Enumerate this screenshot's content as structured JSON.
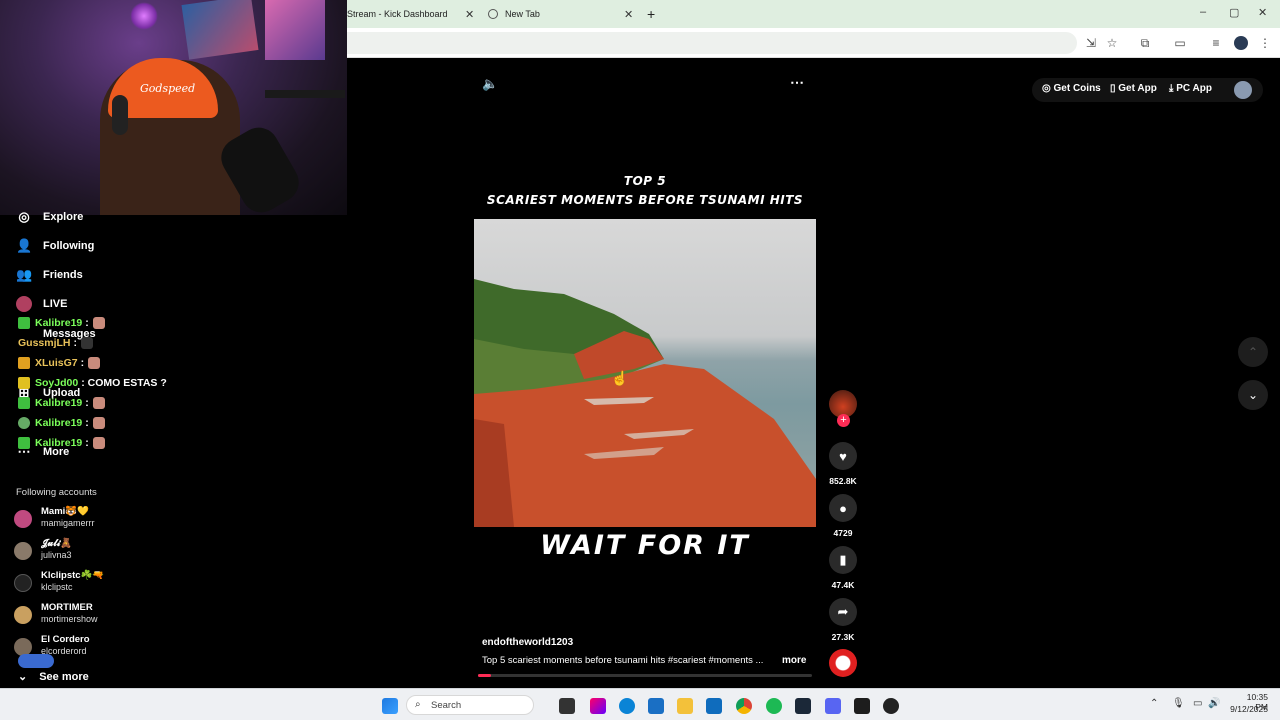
{
  "browser": {
    "tabs": [
      {
        "label": "Stream - Kick Dashboard"
      },
      {
        "label": "New Tab"
      }
    ],
    "new_tab_symbol": "+",
    "window_controls": {
      "minimize": "–",
      "restore": "▢",
      "close": "✕"
    }
  },
  "webcam": {
    "hat_text": "Godspeed"
  },
  "tiktok_nav": {
    "items": [
      {
        "label": "Explore",
        "icon": "compass-icon"
      },
      {
        "label": "Following",
        "icon": "following-icon"
      },
      {
        "label": "Friends",
        "icon": "friends-icon"
      },
      {
        "label": "LIVE",
        "icon": "live-icon"
      },
      {
        "label": "Messages",
        "icon": "messages-icon"
      },
      {
        "label": "Upload",
        "icon": "upload-icon"
      },
      {
        "label": "More",
        "icon": "more-icon"
      }
    ],
    "following_label": "Following accounts",
    "accounts": [
      {
        "name": "Mami🐯💛",
        "handle": "mamigamerrr"
      },
      {
        "name": "𝓙𝓾𝓵𝓲🧸",
        "handle": "julivna3"
      },
      {
        "name": "Klclipstc☘️🔫",
        "handle": "klclipstc"
      },
      {
        "name": "MORTIMER",
        "handle": "mortimershow"
      },
      {
        "name": "El Cordero",
        "handle": "elcorderord"
      }
    ],
    "see_more": "See more"
  },
  "chat": [
    {
      "user": "Kalibre19",
      "msg": ":",
      "emote": true
    },
    {
      "user": "GussmjLH",
      "msg": ":",
      "emote": true
    },
    {
      "user": "XLuisG7",
      "msg": ":",
      "emote": true
    },
    {
      "user": "SoyJd00",
      "msg": ": COMO ESTAS ?",
      "emote": false
    },
    {
      "user": "Kalibre19",
      "msg": ":",
      "emote": true
    },
    {
      "user": "Kalibre19",
      "msg": ":",
      "emote": true
    },
    {
      "user": "Kalibre19",
      "msg": ":",
      "emote": true
    }
  ],
  "video": {
    "title_line1": "TOP 5",
    "title_line2": "SCARIEST MOMENTS BEFORE TSUNAMI HITS",
    "caption": "WAIT FOR IT",
    "author": "endoftheworld1203",
    "description": "Top 5 scariest moments before tsunami hits #scariest  #moments  ...",
    "more": "more",
    "progress": 0.04
  },
  "actions": {
    "likes": "852.8K",
    "comments": "4729",
    "saves": "47.4K",
    "shares": "27.3K"
  },
  "top_actions": {
    "coins": "Get Coins",
    "app": "Get App",
    "pc_app": "PC App"
  },
  "taskbar": {
    "search_placeholder": "Search",
    "time": "10:35 PM",
    "date": "9/12/2025"
  },
  "colors": {
    "tiktok_red": "#fe2c55",
    "chat_green": "#7bff5a",
    "tab_bar": "#dfeee0"
  }
}
